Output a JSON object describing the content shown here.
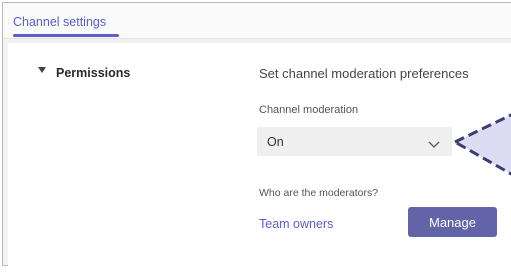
{
  "tabs": {
    "channel_settings": "Channel settings"
  },
  "permissions": {
    "section_title": "Permissions",
    "heading": "Set channel moderation preferences",
    "moderation_label": "Channel moderation",
    "moderation_value": "On",
    "moderators_label": "Who are the moderators?",
    "moderators_value": "Team owners",
    "manage_label": "Manage"
  },
  "colors": {
    "accent": "#5b5fc7",
    "button": "#6264a7",
    "callout_fill": "#dcdcf2",
    "callout_stroke": "#3c3c78"
  },
  "icons": {
    "toggle": "collapse-triangle-icon",
    "select": "chevron-down-icon",
    "pointer": "callout-arrow"
  }
}
